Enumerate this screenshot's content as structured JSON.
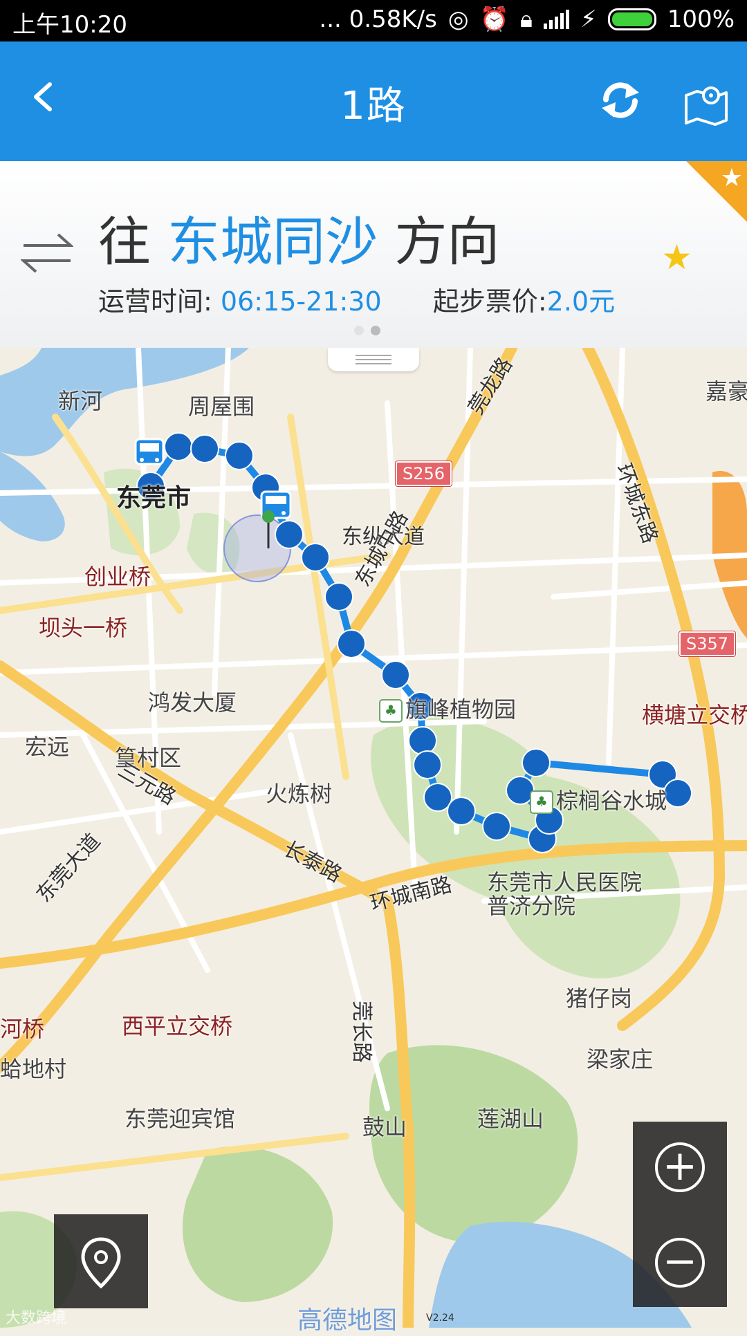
{
  "status_bar": {
    "time": "上午10:20",
    "network_speed": "... 0.58K/s",
    "battery": "100%",
    "battery_level": 1.0,
    "icons": [
      "data-icon",
      "alarm-icon",
      "lock-icon",
      "signal-icon",
      "charging-icon",
      "battery-icon"
    ]
  },
  "header": {
    "title": "1路",
    "back_icon": "chevron-left-icon",
    "refresh_icon": "refresh-icon",
    "map_icon": "map-pin-icon"
  },
  "direction": {
    "prefix": "往",
    "destination": "东城同沙",
    "suffix": "方向",
    "hours_label": "运营时间:",
    "hours_value": "06:15-21:30",
    "fare_label": "起步票价:",
    "fare_value": "2.0元",
    "page_index": 1,
    "page_count": 2
  },
  "map": {
    "labels": {
      "xinhe": "新河",
      "zhouwuwei": "周屋围",
      "dongguanshi": "东莞市",
      "chuangye": "创业桥",
      "batou": "坝头一桥",
      "hongfa": "鸿发大厦",
      "hongyuan": "宏远",
      "huangcun": "篁村区",
      "huolianshu": "火炼树",
      "qifeng": "旗峰植物园",
      "zonglv": "棕榈谷水城",
      "hengtang": "横塘立交桥",
      "hospital": "东莞市人民医院普济分院",
      "zhuguogang": "猪仔岗",
      "liangjia": "梁家庄",
      "xiping": "西平立交桥",
      "hehe": "河桥",
      "gedi": "蛤地村",
      "yingbin": "东莞迎宾馆",
      "gushan": "鼓山",
      "lianhu": "莲湖山",
      "jiahao": "嘉豪"
    },
    "roads": {
      "dongzong": "东纵大道",
      "dongchengzhong": "东城中路",
      "huanchengdong": "环城东路",
      "sanyuan": "三元路",
      "changtai": "长泰路",
      "dongguan": "东莞大道",
      "huanchengnan": "环城南路",
      "guanchang": "莞长路",
      "guanlong": "莞龙路"
    },
    "shields": {
      "s256": "S256",
      "s357": "S357"
    },
    "route_stops": 22,
    "zoom_in_icon": "plus-icon",
    "zoom_out_icon": "minus-icon",
    "locate_icon": "location-pin-icon"
  },
  "watermark": "高德地图",
  "watermark2": "大数跨境",
  "version": "V2.24",
  "colors": {
    "primary": "#1e8fe3",
    "route": "#1565c0",
    "accent": "#f5a623",
    "star": "#f5c518"
  }
}
